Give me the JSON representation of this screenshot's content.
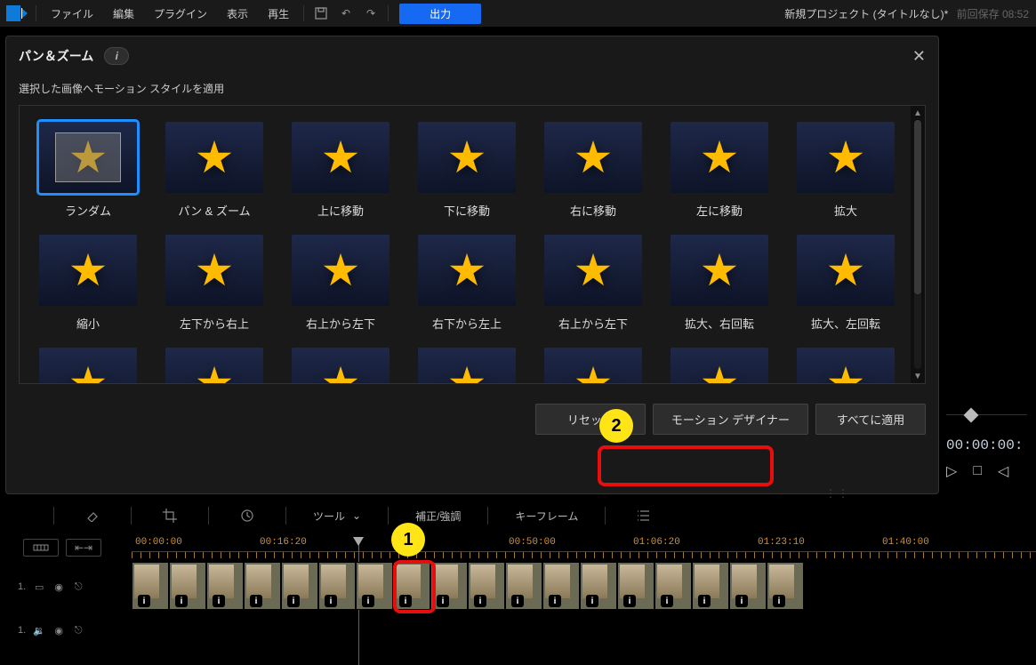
{
  "menubar": {
    "items": [
      "ファイル",
      "編集",
      "プラグイン",
      "表示",
      "再生"
    ],
    "output_label": "出力",
    "right_project": "新規プロジェクト (タイトルなし)*",
    "right_saved": "前回保存 08:52"
  },
  "panel": {
    "title": "パン＆ズーム",
    "subtext": "選択した画像へモーション スタイルを適用",
    "tiles_row1": [
      {
        "label": "ランダム",
        "selected": true
      },
      {
        "label": "パン & ズーム"
      },
      {
        "label": "上に移動"
      },
      {
        "label": "下に移動"
      },
      {
        "label": "右に移動"
      },
      {
        "label": "左に移動"
      },
      {
        "label": "拡大"
      }
    ],
    "tiles_row2": [
      {
        "label": "縮小"
      },
      {
        "label": "左下から右上"
      },
      {
        "label": "右上から左下"
      },
      {
        "label": "右下から左上"
      },
      {
        "label": "右上から左下"
      },
      {
        "label": "拡大、右回転"
      },
      {
        "label": "拡大、左回転"
      }
    ],
    "tiles_row3_count": 7,
    "buttons": {
      "reset": "リセット",
      "motion_designer": "モーション デザイナー",
      "apply_all": "すべてに適用"
    }
  },
  "callouts": {
    "one": "1",
    "two": "2"
  },
  "right": {
    "timecode": "00:00:00:"
  },
  "toolbar": {
    "tools": "ツール",
    "correct": "補正/強調",
    "keyframe": "キーフレーム"
  },
  "ruler": {
    "labels": [
      "00:00:00",
      "00:16:20",
      "00:50:00",
      "01:06:20",
      "01:23:10",
      "01:40:00"
    ]
  },
  "tracks": {
    "video_index": "1.",
    "audio_index": "1.",
    "clip_count": 18
  }
}
